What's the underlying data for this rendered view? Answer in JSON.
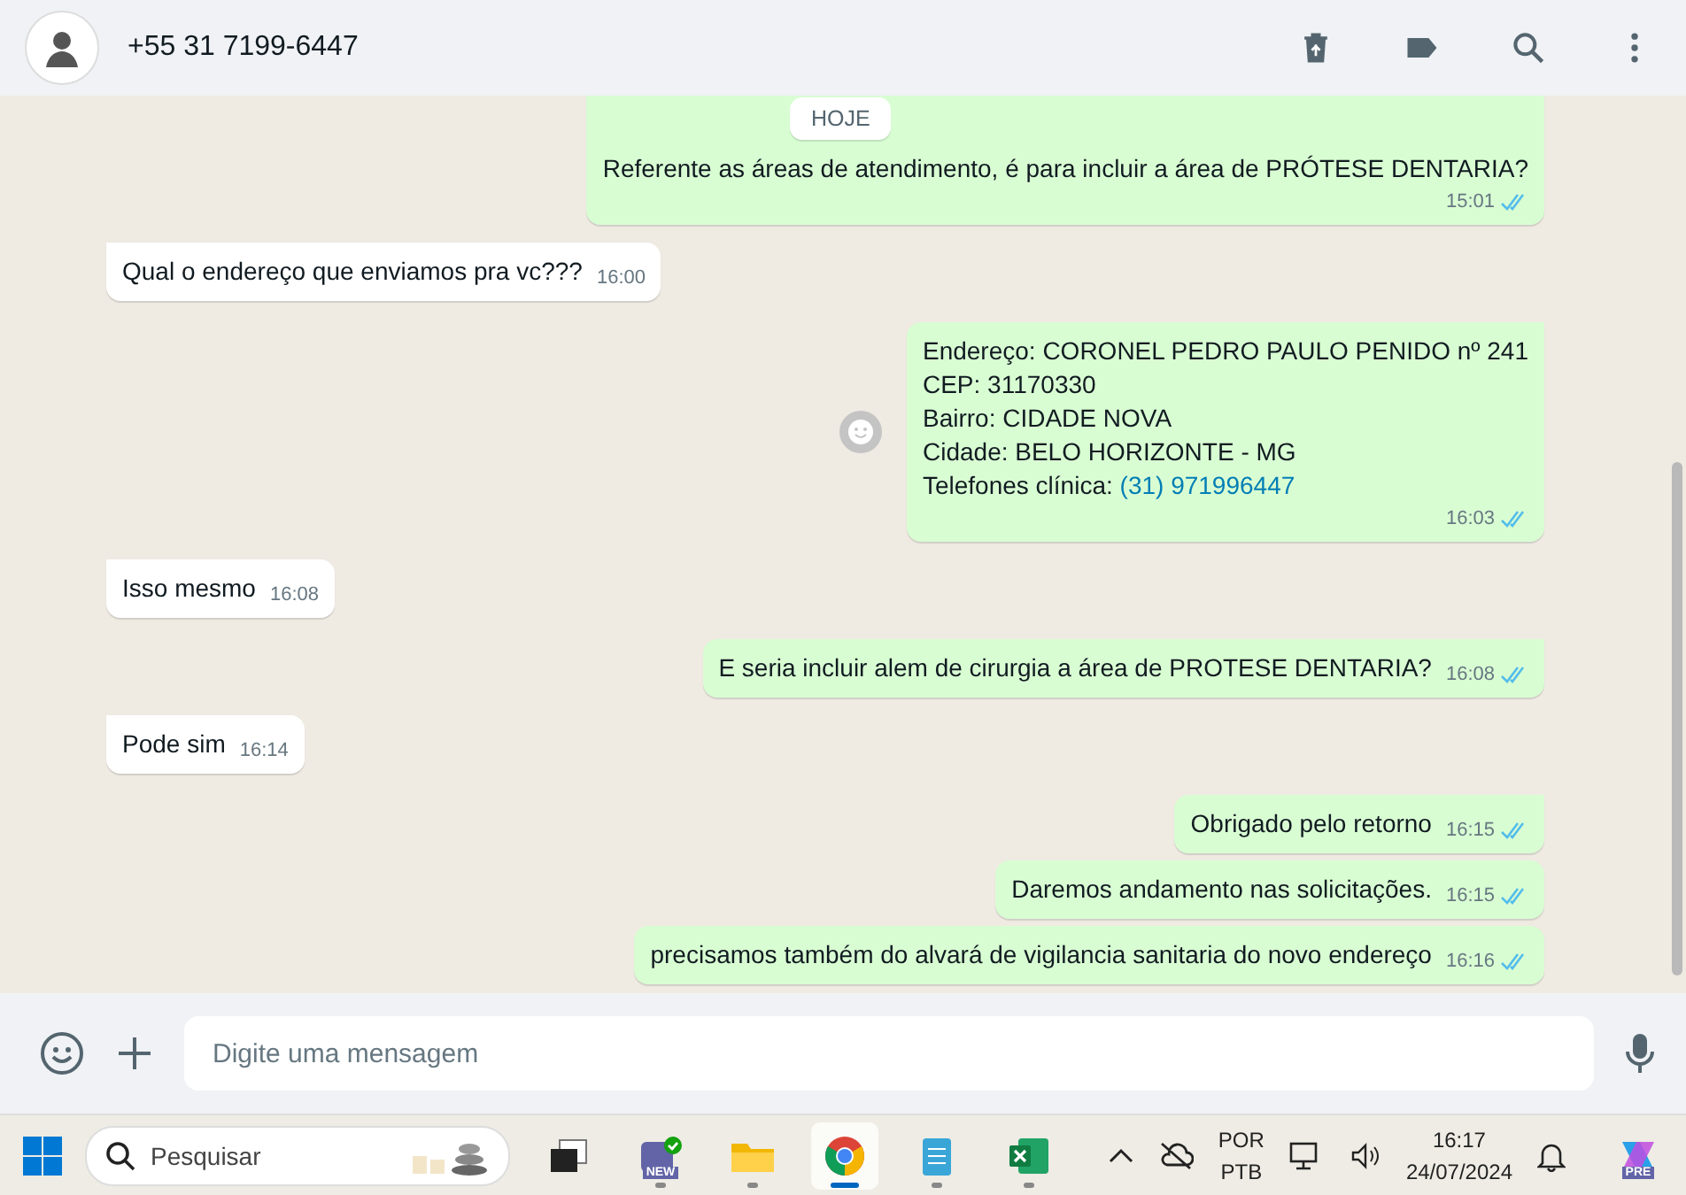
{
  "header": {
    "contact": "+55 31 7199-6447"
  },
  "date_badge": "HOJE",
  "messages": [
    {
      "sent": true,
      "lines": [
        {
          "text": "Referente as áreas de atendimento, é para incluir a área de PRÓTESE DENTARIA?"
        }
      ],
      "time": "15:01",
      "read": true,
      "tail": false
    },
    {
      "sent": false,
      "lines": [
        {
          "text": "Qual o endereço que enviamos pra vc???"
        }
      ],
      "time": "16:00",
      "tail": true
    },
    {
      "sent": true,
      "lines": [
        {
          "text": "Endereço: CORONEL PEDRO PAULO PENIDO nº 241"
        },
        {
          "text": "CEP: 31170330"
        },
        {
          "text": "Bairro: CIDADE NOVA"
        },
        {
          "text": "Cidade: BELO HORIZONTE - MG"
        },
        {
          "text": "Telefones clínica: ",
          "link": "(31) 971996447"
        }
      ],
      "time": "16:03",
      "read": true,
      "tail": true,
      "react": true
    },
    {
      "sent": false,
      "lines": [
        {
          "text": "Isso mesmo"
        }
      ],
      "time": "16:08",
      "tail": true
    },
    {
      "sent": true,
      "lines": [
        {
          "text": "E seria incluir alem de cirurgia a área de PROTESE DENTARIA?"
        }
      ],
      "time": "16:08",
      "read": true,
      "tail": true
    },
    {
      "sent": false,
      "lines": [
        {
          "text": "Pode sim"
        }
      ],
      "time": "16:14",
      "tail": true
    },
    {
      "sent": true,
      "lines": [
        {
          "text": "Obrigado pelo retorno"
        }
      ],
      "time": "16:15",
      "read": true,
      "tail": true
    },
    {
      "sent": true,
      "lines": [
        {
          "text": "Daremos andamento nas solicitações."
        }
      ],
      "time": "16:15",
      "read": true,
      "tail": false
    },
    {
      "sent": true,
      "lines": [
        {
          "text": "precisamos também do alvará de vigilancia sanitaria do novo endereço"
        }
      ],
      "time": "16:16",
      "read": true,
      "tail": false
    }
  ],
  "composer": {
    "placeholder": "Digite uma mensagem"
  },
  "taskbar": {
    "search_placeholder": "Pesquisar",
    "apps": [
      {
        "kind": "taskview",
        "running": false,
        "selected": false
      },
      {
        "kind": "teams",
        "badge": "NEW",
        "running": true,
        "selected": false
      },
      {
        "kind": "folder",
        "running": true,
        "selected": false
      },
      {
        "kind": "chrome",
        "running": true,
        "selected": true
      },
      {
        "kind": "notepad",
        "running": true,
        "selected": false
      },
      {
        "kind": "excel",
        "running": true,
        "selected": false
      }
    ],
    "language": [
      "POR",
      "PTB"
    ],
    "time": "16:17",
    "date": "24/07/2024",
    "copilot_badge": "PRE"
  }
}
